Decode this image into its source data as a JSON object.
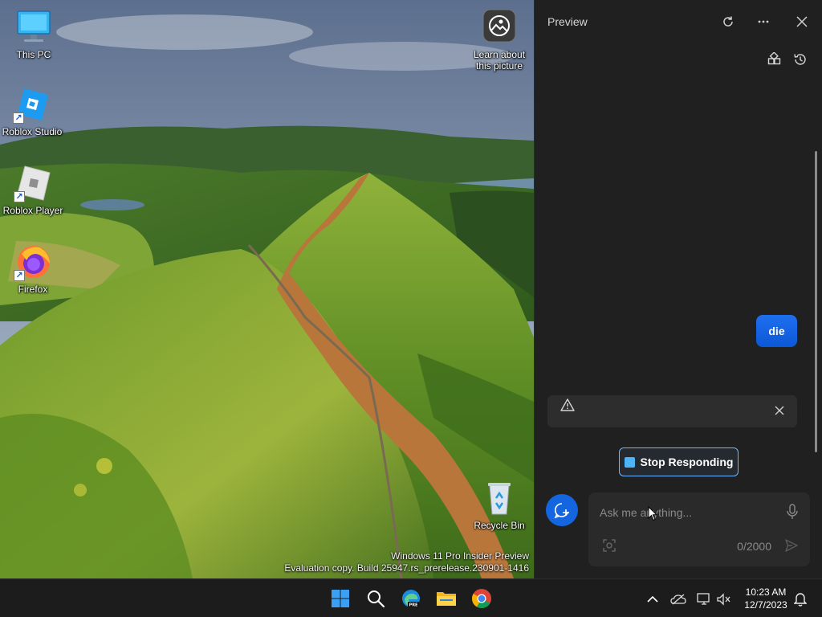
{
  "desktop": {
    "icons": [
      {
        "label": "This PC",
        "icon": "monitor-icon"
      },
      {
        "label": "Roblox Studio",
        "icon": "roblox-studio-icon"
      },
      {
        "label": "Roblox Player",
        "icon": "roblox-player-icon"
      },
      {
        "label": "Firefox",
        "icon": "firefox-icon"
      },
      {
        "label": "Learn about\nthis picture",
        "icon": "spotlight-icon"
      },
      {
        "label": "Recycle Bin",
        "icon": "recycle-bin-icon"
      }
    ],
    "watermark_line1": "Windows 11 Pro Insider Preview",
    "watermark_line2": "Evaluation copy. Build 25947.rs_prerelease.230901-1416"
  },
  "panel": {
    "title": "Preview",
    "header_icons": [
      "refresh-icon",
      "more-icon",
      "close-icon"
    ],
    "tool_icons": [
      "plugins-icon",
      "history-icon"
    ],
    "user_message": "die",
    "warning_icon": "warning-icon",
    "stop_label": "Stop Responding",
    "input_placeholder": "Ask me anything...",
    "char_count": "0/2000",
    "colors": {
      "accent": "#1466e0",
      "bubble": "#1668eb",
      "stop_border": "#6fb6ff"
    }
  },
  "taskbar": {
    "apps": [
      "windows-start-icon",
      "search-icon",
      "edge-preview-icon",
      "file-explorer-icon",
      "chrome-icon"
    ],
    "tray": [
      "chevron-up-icon",
      "onedrive-icon",
      "network-icon",
      "volume-muted-icon",
      "notification-icon"
    ],
    "time": "10:23 AM",
    "date": "12/7/2023"
  }
}
